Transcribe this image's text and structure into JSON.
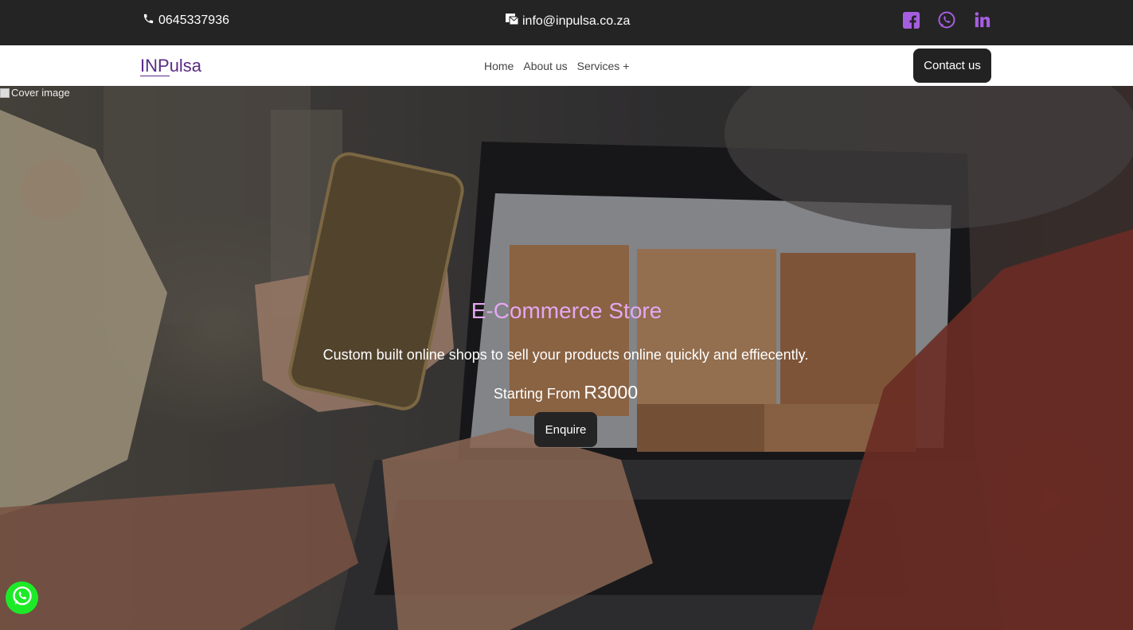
{
  "topbar": {
    "phone": "0645337936",
    "email": "info@inpulsa.co.za",
    "socials": [
      "facebook-icon",
      "whatsapp-icon",
      "linkedin-icon"
    ],
    "social_color": "#a65ee0"
  },
  "nav": {
    "logo_part1": "INP",
    "logo_part2": "ulsa",
    "links": [
      "Home",
      "About us",
      "Services +"
    ],
    "contact_label": "Contact us"
  },
  "hero": {
    "image_alt": "Cover image",
    "title": "E-Commerce Store",
    "subtitle": "Custom built online shops to sell your products online quickly and effiecently.",
    "price_label": "Starting From",
    "price_value": "R3000",
    "enquire_label": "Enquire"
  },
  "floating": {
    "icon": "whatsapp-icon",
    "color": "#1dea27"
  }
}
